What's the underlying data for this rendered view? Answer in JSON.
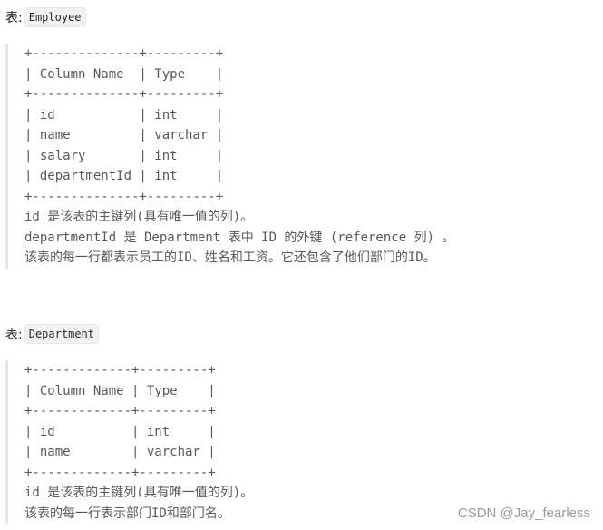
{
  "sections": [
    {
      "label": "表:",
      "table_name": "Employee",
      "schema_lines": [
        "+--------------+---------+",
        "| Column Name  | Type    |",
        "+--------------+---------+",
        "| id           | int     |",
        "| name         | varchar |",
        "| salary       | int     |",
        "| departmentId | int     |",
        "+--------------+---------+"
      ],
      "columns": [
        {
          "name": "id",
          "type": "int"
        },
        {
          "name": "name",
          "type": "varchar"
        },
        {
          "name": "salary",
          "type": "int"
        },
        {
          "name": "departmentId",
          "type": "int"
        }
      ],
      "notes": [
        "id 是该表的主键列(具有唯一值的列)。",
        "departmentId 是 Department 表中 ID 的外键 (reference 列) 。",
        "该表的每一行都表示员工的ID、姓名和工资。它还包含了他们部门的ID。"
      ]
    },
    {
      "label": "表:",
      "table_name": "Department",
      "schema_lines": [
        "+-------------+---------+",
        "| Column Name | Type    |",
        "+-------------+---------+",
        "| id          | int     |",
        "| name        | varchar |",
        "+-------------+---------+"
      ],
      "columns": [
        {
          "name": "id",
          "type": "int"
        },
        {
          "name": "name",
          "type": "varchar"
        }
      ],
      "notes": [
        "id 是该表的主键列(具有唯一值的列)。",
        "该表的每一行表示部门ID和部门名。"
      ]
    }
  ],
  "watermark": "CSDN @Jay_fearless"
}
